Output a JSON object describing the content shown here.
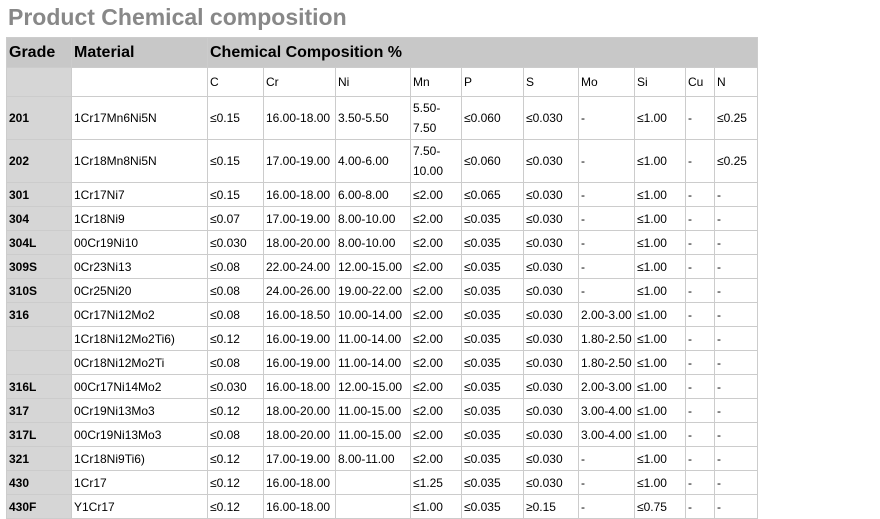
{
  "title": "Product Chemical composition",
  "headers": {
    "grade": "Grade",
    "material": "Material",
    "composition": "Chemical Composition %"
  },
  "elements": [
    "C",
    "Cr",
    "Ni",
    "Mn",
    "P",
    "S",
    "Mo",
    "Si",
    "Cu",
    "N"
  ],
  "rows": [
    {
      "grade": "201",
      "material": "1Cr17Mn6Ni5N",
      "values": [
        "≤0.15",
        "16.00-18.00",
        "3.50-5.50",
        "5.50-7.50",
        "≤0.060",
        "≤0.030",
        "-",
        "≤1.00",
        "-",
        "≤0.25"
      ]
    },
    {
      "grade": "202",
      "material": "1Cr18Mn8Ni5N",
      "values": [
        "≤0.15",
        "17.00-19.00",
        "4.00-6.00",
        "7.50-10.00",
        "≤0.060",
        "≤0.030",
        "-",
        "≤1.00",
        "-",
        "≤0.25"
      ]
    },
    {
      "grade": "301",
      "material": "1Cr17Ni7",
      "values": [
        "≤0.15",
        "16.00-18.00",
        "6.00-8.00",
        "≤2.00",
        "≤0.065",
        "≤0.030",
        "-",
        "≤1.00",
        "-",
        "-"
      ]
    },
    {
      "grade": "304",
      "material": "1Cr18Ni9",
      "values": [
        "≤0.07",
        "17.00-19.00",
        "8.00-10.00",
        "≤2.00",
        "≤0.035",
        "≤0.030",
        "-",
        "≤1.00",
        "-",
        "-"
      ]
    },
    {
      "grade": "304L",
      "material": "00Cr19Ni10",
      "values": [
        "≤0.030",
        "18.00-20.00",
        "8.00-10.00",
        "≤2.00",
        "≤0.035",
        "≤0.030",
        "-",
        "≤1.00",
        "-",
        "-"
      ]
    },
    {
      "grade": "309S",
      "material": "0Cr23Ni13",
      "values": [
        "≤0.08",
        "22.00-24.00",
        "12.00-15.00",
        "≤2.00",
        "≤0.035",
        "≤0.030",
        "-",
        "≤1.00",
        "-",
        "-"
      ]
    },
    {
      "grade": "310S",
      "material": "0Cr25Ni20",
      "values": [
        "≤0.08",
        "24.00-26.00",
        "19.00-22.00",
        "≤2.00",
        "≤0.035",
        "≤0.030",
        "-",
        "≤1.00",
        "-",
        "-"
      ]
    },
    {
      "grade": "316",
      "material": "0Cr17Ni12Mo2",
      "values": [
        "≤0.08",
        "16.00-18.50",
        "10.00-14.00",
        "≤2.00",
        "≤0.035",
        "≤0.030",
        "2.00-3.00",
        "≤1.00",
        "-",
        "-"
      ]
    },
    {
      "grade": "",
      "material": "1Cr18Ni12Mo2Ti6)",
      "values": [
        "≤0.12",
        "16.00-19.00",
        "11.00-14.00",
        "≤2.00",
        "≤0.035",
        "≤0.030",
        "1.80-2.50",
        "≤1.00",
        "-",
        "-"
      ]
    },
    {
      "grade": "",
      "material": "0Cr18Ni12Mo2Ti",
      "values": [
        "≤0.08",
        "16.00-19.00",
        "11.00-14.00",
        "≤2.00",
        "≤0.035",
        "≤0.030",
        "1.80-2.50",
        "≤1.00",
        "-",
        "-"
      ]
    },
    {
      "grade": "316L",
      "material": "00Cr17Ni14Mo2",
      "values": [
        "≤0.030",
        "16.00-18.00",
        "12.00-15.00",
        "≤2.00",
        "≤0.035",
        "≤0.030",
        "2.00-3.00",
        "≤1.00",
        "-",
        "-"
      ]
    },
    {
      "grade": "317",
      "material": "0Cr19Ni13Mo3",
      "values": [
        "≤0.12",
        "18.00-20.00",
        "11.00-15.00",
        "≤2.00",
        "≤0.035",
        "≤0.030",
        "3.00-4.00",
        "≤1.00",
        "-",
        "-"
      ]
    },
    {
      "grade": "317L",
      "material": "00Cr19Ni13Mo3",
      "values": [
        "≤0.08",
        "18.00-20.00",
        "11.00-15.00",
        "≤2.00",
        "≤0.035",
        "≤0.030",
        "3.00-4.00",
        "≤1.00",
        "-",
        "-"
      ]
    },
    {
      "grade": "321",
      "material": "1Cr18Ni9Ti6)",
      "values": [
        "≤0.12",
        "17.00-19.00",
        "8.00-11.00",
        "≤2.00",
        "≤0.035",
        "≤0.030",
        "-",
        "≤1.00",
        "-",
        "-"
      ]
    },
    {
      "grade": "430",
      "material": "1Cr17",
      "values": [
        "≤0.12",
        "16.00-18.00",
        "",
        "≤1.25",
        "≤0.035",
        "≤0.030",
        "-",
        "≤1.00",
        "-",
        "-"
      ]
    },
    {
      "grade": "430F",
      "material": "Y1Cr17",
      "values": [
        "≤0.12",
        "16.00-18.00",
        "",
        "≤1.00",
        "≤0.035",
        "≥0.15",
        "-",
        "≤0.75",
        "-",
        "-"
      ]
    }
  ]
}
